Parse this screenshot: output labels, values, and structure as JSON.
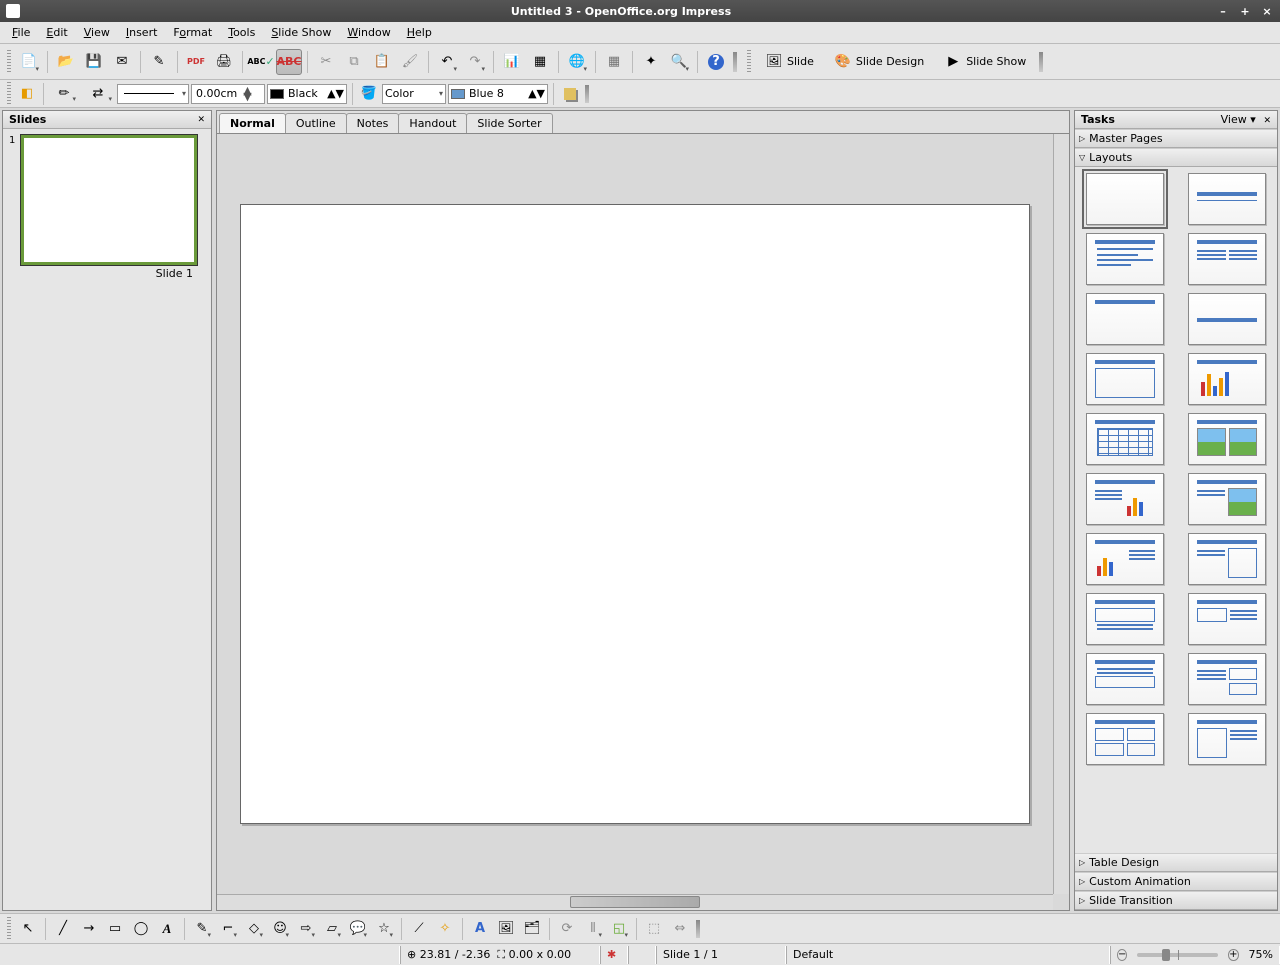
{
  "window": {
    "title": "Untitled 3 - OpenOffice.org Impress"
  },
  "menu": [
    "File",
    "Edit",
    "View",
    "Insert",
    "Format",
    "Tools",
    "Slide Show",
    "Window",
    "Help"
  ],
  "toolbar_right": {
    "slide": "Slide",
    "slide_design": "Slide Design",
    "slide_show": "Slide Show"
  },
  "format_toolbar": {
    "line_width": "0.00cm",
    "line_color_label": "Black",
    "fill_type": "Color",
    "fill_color": "Blue 8"
  },
  "slides_panel": {
    "title": "Slides",
    "items": [
      {
        "num": "1",
        "label": "Slide 1"
      }
    ]
  },
  "view_tabs": [
    "Normal",
    "Outline",
    "Notes",
    "Handout",
    "Slide Sorter"
  ],
  "tasks_panel": {
    "title": "Tasks",
    "view_label": "View",
    "sections": {
      "master_pages": "Master Pages",
      "layouts": "Layouts",
      "table_design": "Table Design",
      "custom_animation": "Custom Animation",
      "slide_transition": "Slide Transition"
    }
  },
  "status": {
    "coords": "23.81 / -2.36",
    "size": "0.00 x 0.00",
    "slide": "Slide 1 / 1",
    "template": "Default",
    "zoom": "75%"
  }
}
